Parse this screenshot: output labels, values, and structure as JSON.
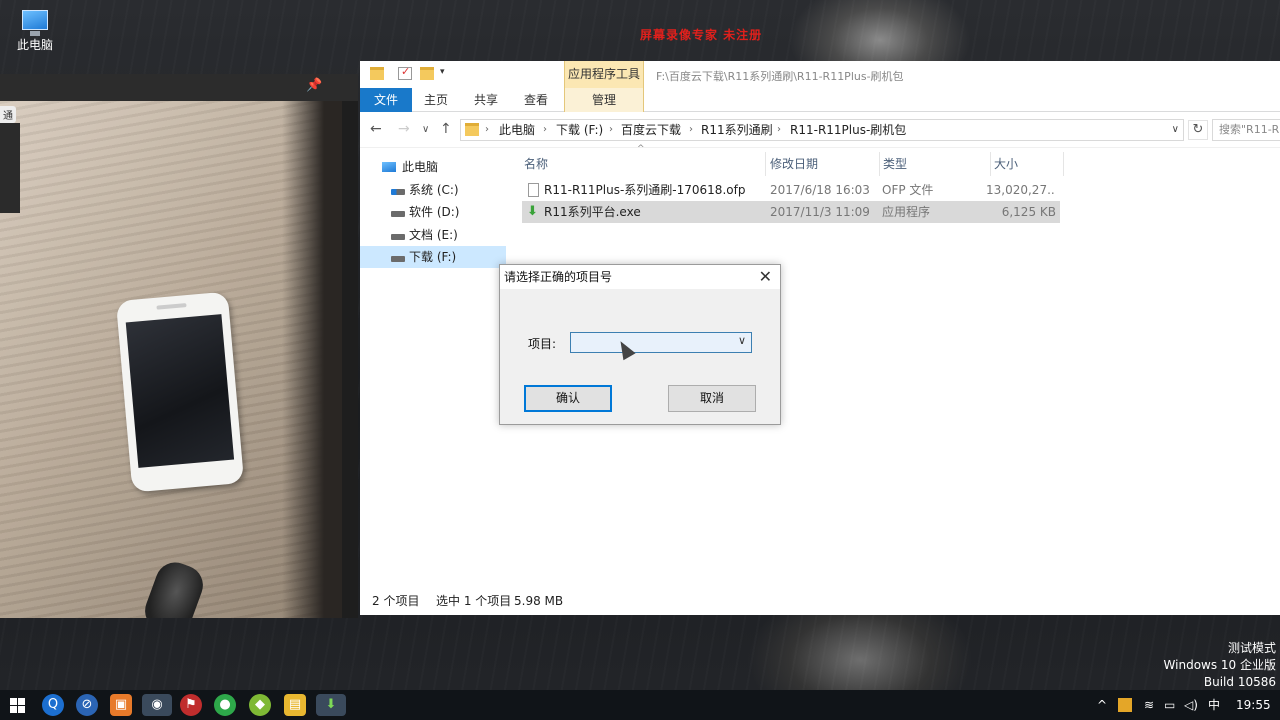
{
  "desktop": {
    "icon_label": "此电脑",
    "watermark": "屏幕录像专家 未注册",
    "windows_watermark": [
      "测试模式",
      "Windows 10 企业版",
      "Build 10586"
    ]
  },
  "camera_window": {
    "tag": "通"
  },
  "explorer": {
    "context_tab_title": "应用程序工具",
    "title_path": "F:\\百度云下载\\R11系列通刷\\R11-R11Plus-刷机包",
    "tabs": [
      "文件",
      "主页",
      "共享",
      "查看",
      "管理"
    ],
    "breadcrumb": [
      "此电脑",
      "下载 (F:)",
      "百度云下载",
      "R11系列通刷",
      "R11-R11Plus-刷机包"
    ],
    "search_placeholder": "搜索\"R11-R...",
    "nav_tree": [
      "此电脑",
      "系统 (C:)",
      "软件 (D:)",
      "文档 (E:)",
      "下载 (F:)"
    ],
    "columns": [
      "名称",
      "修改日期",
      "类型",
      "大小"
    ],
    "files": [
      {
        "name": "R11-R11Plus-系列通刷-170618.ofp",
        "date": "2017/6/18 16:03",
        "type": "OFP 文件",
        "size": "13,020,27..."
      },
      {
        "name": "R11系列平台.exe",
        "date": "2017/11/3 11:09",
        "type": "应用程序",
        "size": "6,125 KB"
      }
    ],
    "status": {
      "count": "2 个项目",
      "selected": "选中 1 个项目",
      "size": "5.98 MB"
    }
  },
  "dialog": {
    "title": "请选择正确的项目号",
    "label": "项目:",
    "select_value": "",
    "ok": "确认",
    "cancel": "取消"
  },
  "taskbar": {
    "ime": "中",
    "time": "19:55"
  },
  "colors": {
    "accent": "#1979ca",
    "context_tab": "#fbe7b3",
    "watermark": "#e0201c",
    "selection": "#cce8ff"
  }
}
